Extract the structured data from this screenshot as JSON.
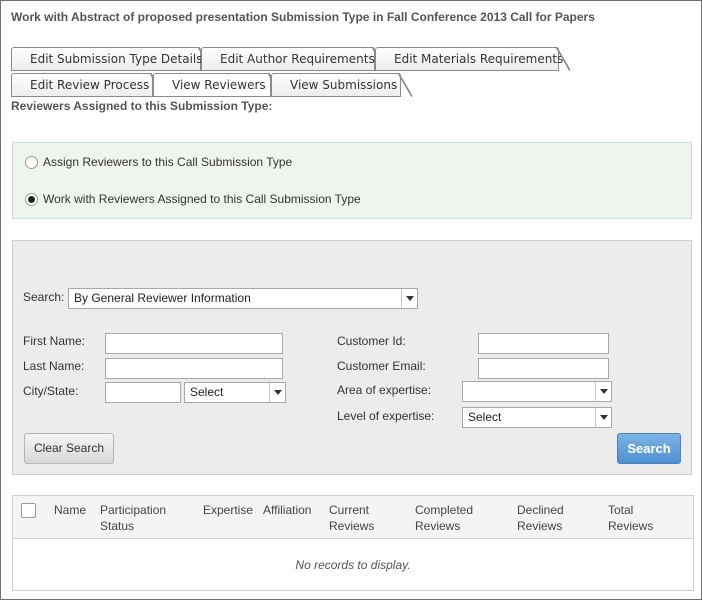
{
  "page_title": "Work with Abstract of proposed presentation Submission Type in Fall Conference 2013 Call for Papers",
  "tabs_row1": [
    "Edit Submission Type Details",
    "Edit Author Requirements",
    "Edit Materials Requirements"
  ],
  "tabs_row2": [
    "Edit Review Process",
    "View Reviewers",
    "View Submissions"
  ],
  "active_tab": "View Reviewers",
  "section_label": "Reviewers Assigned to this Submission Type:",
  "radio_options": [
    {
      "label": "Assign Reviewers to this Call Submission Type",
      "checked": false
    },
    {
      "label": "Work with Reviewers Assigned to this Call Submission Type",
      "checked": true
    }
  ],
  "search": {
    "label": "Search:",
    "mode": "By General Reviewer Information",
    "first_name_label": "First Name:",
    "first_name_value": "",
    "last_name_label": "Last Name:",
    "last_name_value": "",
    "city_state_label": "City/State:",
    "city_value": "",
    "state_value": "Select",
    "customer_id_label": "Customer Id:",
    "customer_id_value": "",
    "customer_email_label": "Customer Email:",
    "customer_email_value": "",
    "area_label": "Area of expertise:",
    "area_value": "",
    "level_label": "Level of expertise:",
    "level_value": "Select",
    "clear_button": "Clear Search",
    "search_button": "Search"
  },
  "grid": {
    "columns": [
      {
        "line1": "Name",
        "line2": ""
      },
      {
        "line1": "Participation",
        "line2": "Status"
      },
      {
        "line1": "Expertise",
        "line2": ""
      },
      {
        "line1": "Affiliation",
        "line2": ""
      },
      {
        "line1": "Current",
        "line2": "Reviews"
      },
      {
        "line1": "Completed",
        "line2": "Reviews"
      },
      {
        "line1": "Declined",
        "line2": "Reviews"
      },
      {
        "line1": "Total",
        "line2": "Reviews"
      }
    ],
    "empty_text": "No records to display."
  }
}
